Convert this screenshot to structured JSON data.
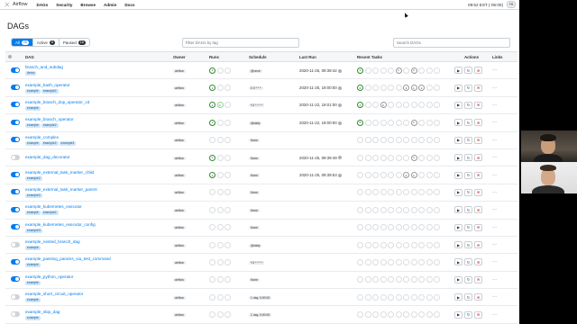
{
  "navbar": {
    "brand": "Airflow",
    "items": [
      "DAGs",
      "Security",
      "Browse",
      "Admin",
      "Docs"
    ],
    "clock": "09:52 EST (-05:00)",
    "user": "FB"
  },
  "page": {
    "title": "DAGs"
  },
  "filters": {
    "all_label": "All",
    "all_count": "26",
    "active_label": "Active",
    "active_count": "8",
    "paused_label": "Paused",
    "paused_count": "18",
    "tag_placeholder": "Filter DAGs by tag",
    "search_placeholder": "Search DAGs"
  },
  "columns": [
    "DAG",
    "Owner",
    "Runs",
    "Schedule",
    "Last Run",
    "Recent Tasks",
    "Actions",
    "Links"
  ],
  "rows": [
    {
      "name": "branch_and_subdag",
      "tags": [
        "demo"
      ],
      "owner": "airflow",
      "on": true,
      "runs": [
        "1"
      ],
      "schedule": "@once",
      "last_run": "2020-11-25, 09:39:42",
      "recent": [
        "1",
        "",
        "",
        "",
        "",
        "1",
        "",
        "2"
      ]
    },
    {
      "name": "example_bash_operator",
      "tags": [
        "example",
        "example2"
      ],
      "owner": "airflow",
      "on": true,
      "runs": [
        "1"
      ],
      "schedule": "0 0 * * *",
      "last_run": "2020-11-25, 19:00:00",
      "recent": [
        "6",
        "",
        "",
        "",
        "",
        "",
        "3",
        "1",
        "2"
      ]
    },
    {
      "name": "example_branch_dop_operator_v3",
      "tags": [
        "example"
      ],
      "owner": "airflow",
      "on": true,
      "runs": [
        "1",
        "1"
      ],
      "schedule": "*/1 * * * *",
      "last_run": "2020-11-22, 19:01:00",
      "recent": [
        "4",
        "",
        "",
        "2"
      ]
    },
    {
      "name": "example_branch_operator",
      "tags": [
        "example",
        "example2"
      ],
      "owner": "airflow",
      "on": true,
      "runs": [
        "1"
      ],
      "schedule": "@daily",
      "last_run": "2020-11-22, 19:00:00",
      "recent": [
        "5",
        "",
        "",
        "",
        "",
        "",
        "",
        "1"
      ]
    },
    {
      "name": "example_complex",
      "tags": [
        "example",
        "example2",
        "example3"
      ],
      "owner": "airflow",
      "on": true,
      "runs": [],
      "schedule": "None",
      "last_run": "",
      "recent": []
    },
    {
      "name": "example_dag_decorator",
      "tags": [],
      "owner": "airflow",
      "on": false,
      "runs": [
        "1"
      ],
      "schedule": "None",
      "last_run": "2020-11-25, 09:39:49",
      "recent": [
        "",
        "",
        "",
        "",
        "",
        "",
        "",
        "1"
      ]
    },
    {
      "name": "example_external_task_marker_child",
      "tags": [
        "example2"
      ],
      "owner": "airflow",
      "on": true,
      "runs": [
        "1"
      ],
      "schedule": "None",
      "last_run": "2020-11-25, 09:39:53",
      "recent": [
        "",
        "",
        "",
        "",
        "",
        "",
        "2",
        "1"
      ]
    },
    {
      "name": "example_external_task_marker_parent",
      "tags": [
        "example2"
      ],
      "owner": "airflow",
      "on": true,
      "runs": [],
      "schedule": "None",
      "last_run": "",
      "recent": []
    },
    {
      "name": "example_kubernetes_executor",
      "tags": [
        "example",
        "example2"
      ],
      "owner": "airflow",
      "on": true,
      "runs": [],
      "schedule": "None",
      "last_run": "",
      "recent": []
    },
    {
      "name": "example_kubernetes_executor_config",
      "tags": [
        "example3"
      ],
      "owner": "airflow",
      "on": true,
      "runs": [],
      "schedule": "None",
      "last_run": "",
      "recent": []
    },
    {
      "name": "example_nested_branch_dag",
      "tags": [
        "example"
      ],
      "owner": "airflow",
      "on": false,
      "runs": [],
      "schedule": "@daily",
      "last_run": "",
      "recent": []
    },
    {
      "name": "example_passing_params_via_test_command",
      "tags": [
        "example"
      ],
      "owner": "airflow",
      "on": true,
      "runs": [],
      "schedule": "*/1 * * * *",
      "last_run": "",
      "recent": []
    },
    {
      "name": "example_python_operator",
      "tags": [
        "example"
      ],
      "owner": "airflow",
      "on": true,
      "runs": [],
      "schedule": "None",
      "last_run": "",
      "recent": []
    },
    {
      "name": "example_short_circuit_operator",
      "tags": [
        "example"
      ],
      "owner": "airflow",
      "on": false,
      "runs": [],
      "schedule": "1 day, 0:00:00",
      "last_run": "",
      "recent": []
    },
    {
      "name": "example_skip_dag",
      "tags": [
        "example"
      ],
      "owner": "airflow",
      "on": false,
      "runs": [],
      "schedule": "1 day, 0:00:00",
      "last_run": "",
      "recent": []
    }
  ],
  "colors": {
    "accent": "#017cee",
    "success": "#2e8a2e",
    "tag_bg": "#cfe6fa"
  }
}
